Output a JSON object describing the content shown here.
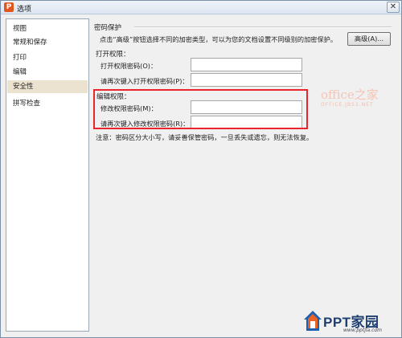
{
  "window": {
    "title": "选项",
    "app_icon_letter": "P",
    "close_glyph": "✕"
  },
  "sidebar": {
    "items": [
      {
        "label": "视图",
        "active": false
      },
      {
        "label": "常规和保存",
        "active": false
      },
      {
        "label": "打印",
        "active": false
      },
      {
        "label": "编辑",
        "active": false
      },
      {
        "label": "安全性",
        "active": true
      },
      {
        "label": "拼写检查",
        "active": false
      }
    ],
    "active_color": "#ebe3cf"
  },
  "security": {
    "group_title": "密码保护",
    "description": "点击“高级”按钮选择不同的加密类型，可以为您的文档设置不同级别的加密保护。",
    "advanced_button": "高级(A)...",
    "open_section": {
      "title": "打开权限：",
      "password_label": "打开权限密码(O)：",
      "password_value": "",
      "confirm_label": "请再次键入打开权限密码(P)：",
      "confirm_value": ""
    },
    "edit_section": {
      "title": "编辑权限：",
      "password_label": "修改权限密码(M)：",
      "password_value": "",
      "confirm_label": "请再次键入修改权限密码(R)：",
      "confirm_value": ""
    },
    "note": "注意：密码区分大小写，请妥善保管密码，一旦丢失或遗忘，则无法恢复。"
  },
  "annotation": {
    "highlight_color": "#e8262c"
  },
  "watermarks": {
    "office_line1": "office之家",
    "office_line2": "OFFICE.JB51.NET",
    "ppt_brand": "PPT家园",
    "ppt_url": "www.pptjia.com"
  }
}
